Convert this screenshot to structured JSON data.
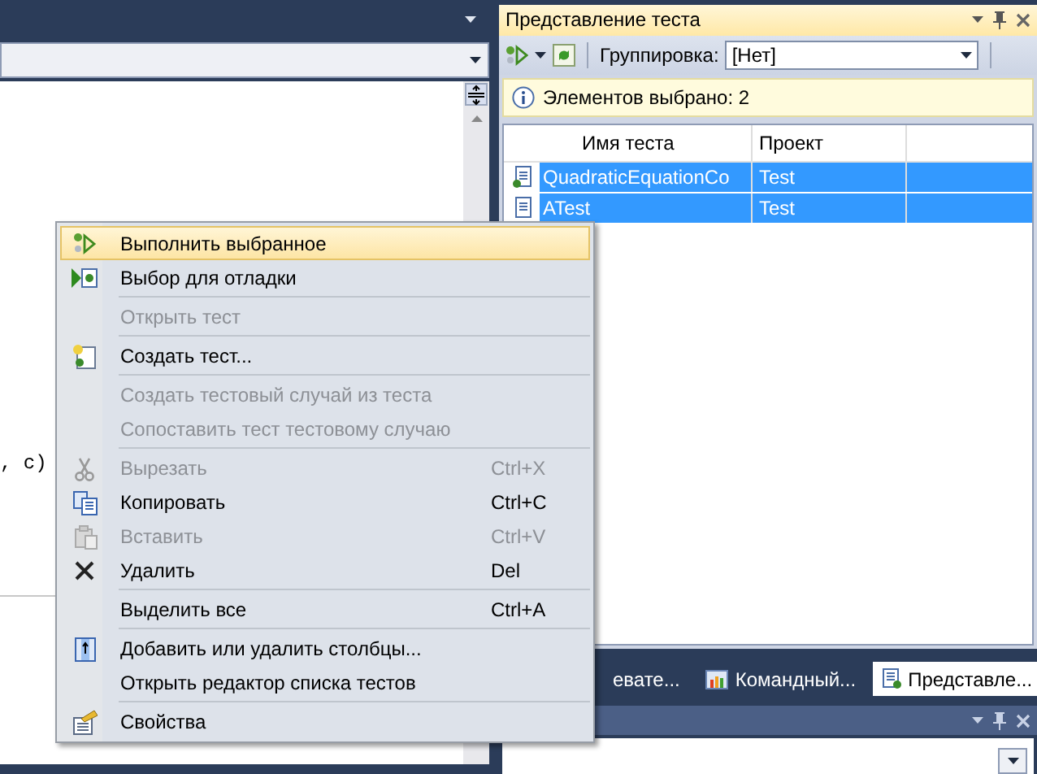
{
  "editor": {
    "code_line": ", c)"
  },
  "test_view": {
    "title": "Представление теста",
    "toolbar": {
      "group_label": "Группировка:",
      "group_value": "[Нет]"
    },
    "info": "Элементов выбрано: 2",
    "table": {
      "columns": [
        "Имя теста",
        "Проект"
      ],
      "rows": [
        {
          "name": "QuadraticEquationCo",
          "project": "Test",
          "selected": true
        },
        {
          "name": "ATest",
          "project": "Test",
          "selected": true
        }
      ]
    },
    "tabs": [
      {
        "label": "евате...",
        "selected": false
      },
      {
        "label": "Командный...",
        "selected": false
      },
      {
        "label": "Представле...",
        "selected": true
      }
    ]
  },
  "context_menu": {
    "groups": [
      [
        {
          "label": "Выполнить выбранное",
          "selected": true,
          "disabled": false
        },
        {
          "label": "Выбор для отладки",
          "selected": false,
          "disabled": false
        }
      ],
      [
        {
          "label": "Открыть тест",
          "selected": false,
          "disabled": true
        }
      ],
      [
        {
          "label": "Создать тест...",
          "selected": false,
          "disabled": false
        }
      ],
      [
        {
          "label": "Создать тестовый случай из теста",
          "selected": false,
          "disabled": true
        },
        {
          "label": "Сопоставить тест тестовому случаю",
          "selected": false,
          "disabled": true
        }
      ],
      [
        {
          "label": "Вырезать",
          "shortcut": "Ctrl+X",
          "selected": false,
          "disabled": true
        },
        {
          "label": "Копировать",
          "shortcut": "Ctrl+C",
          "selected": false,
          "disabled": false
        },
        {
          "label": "Вставить",
          "shortcut": "Ctrl+V",
          "selected": false,
          "disabled": true
        },
        {
          "label": "Удалить",
          "shortcut": "Del",
          "selected": false,
          "disabled": false
        }
      ],
      [
        {
          "label": "Выделить все",
          "shortcut": "Ctrl+A",
          "selected": false,
          "disabled": false
        }
      ],
      [
        {
          "label": "Добавить или удалить столбцы...",
          "selected": false,
          "disabled": false
        },
        {
          "label": "Открыть редактор списка тестов",
          "selected": false,
          "disabled": false
        }
      ],
      [
        {
          "label": "Свойства",
          "selected": false,
          "disabled": false
        }
      ]
    ]
  }
}
